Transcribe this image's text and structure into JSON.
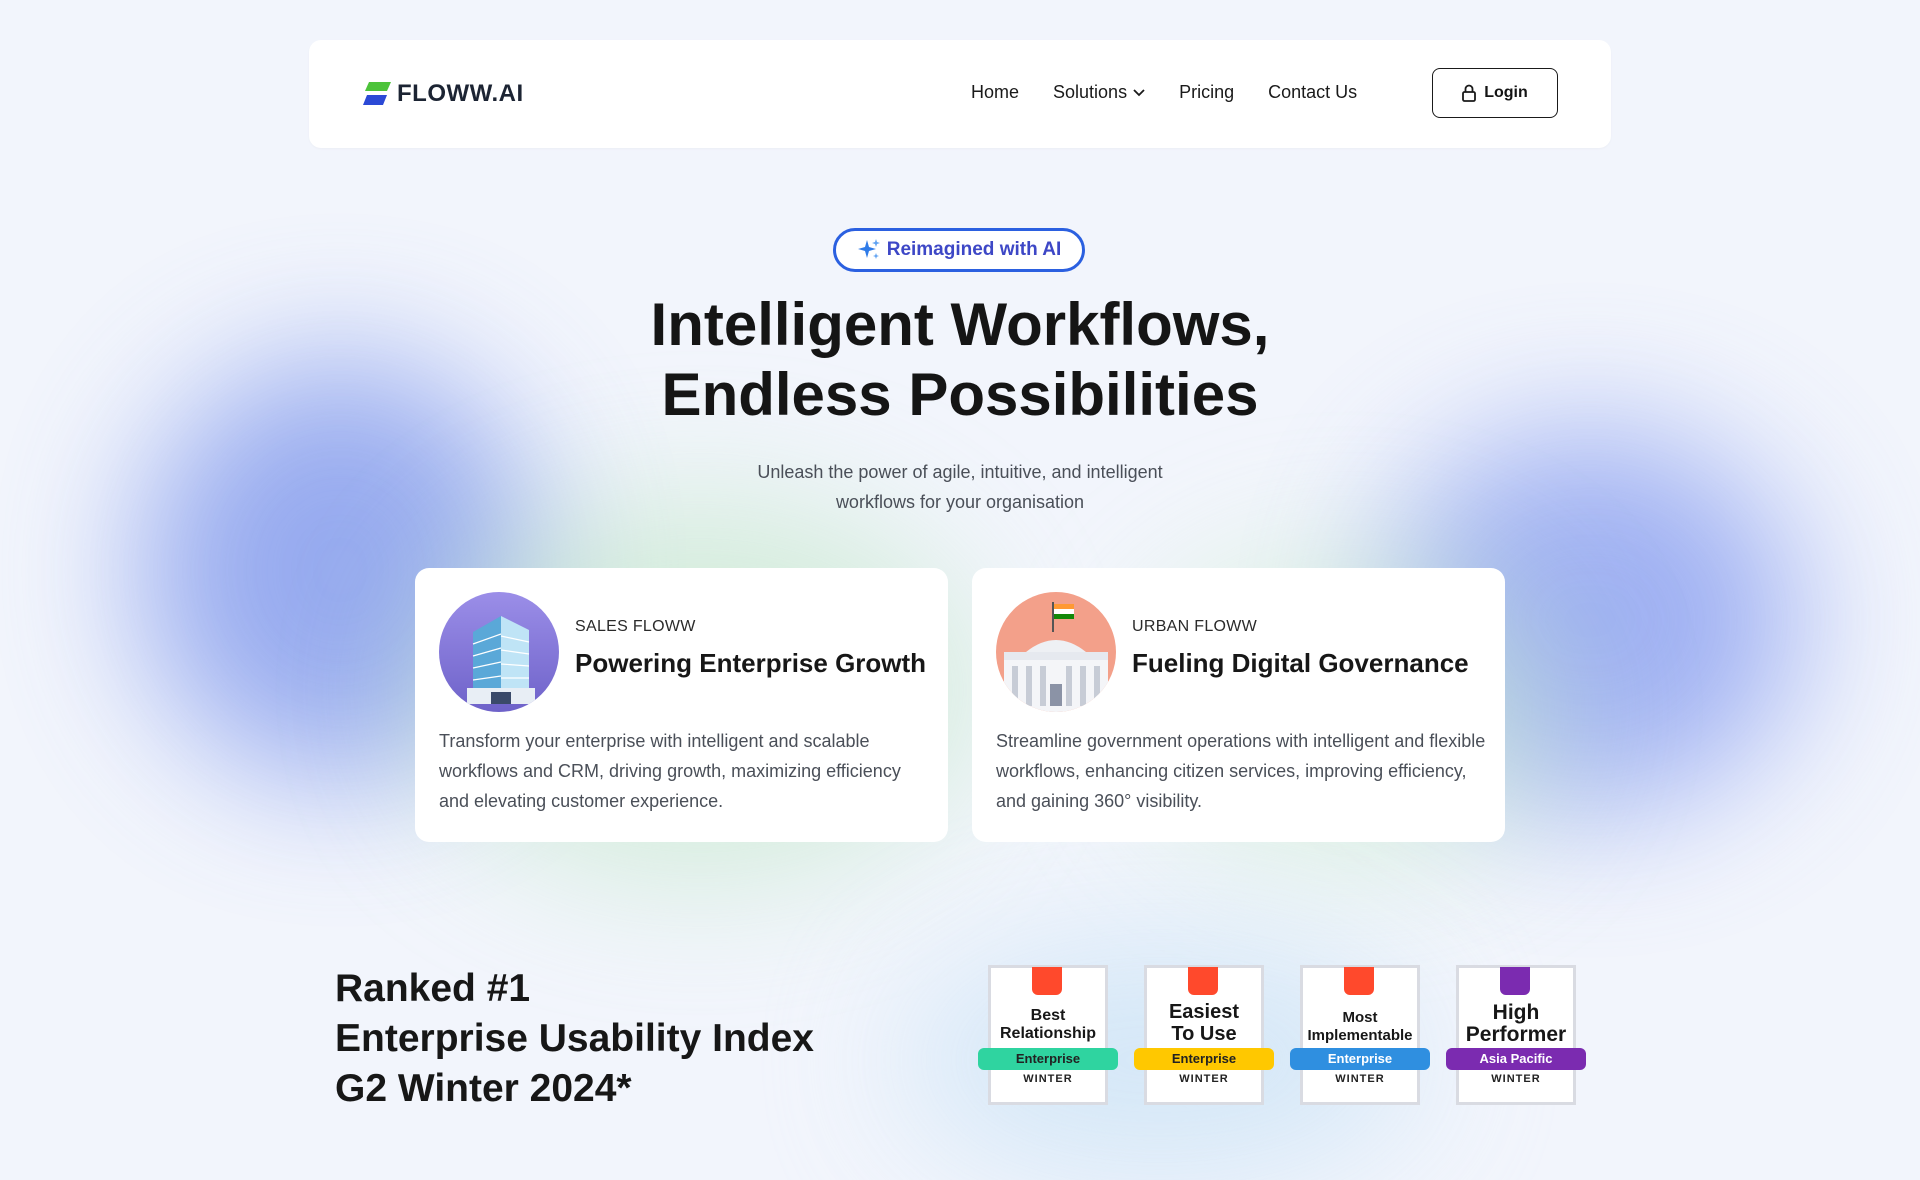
{
  "brand": {
    "name": "FLOWW.AI"
  },
  "nav": {
    "items": [
      {
        "label": "Home"
      },
      {
        "label": "Solutions"
      },
      {
        "label": "Pricing"
      },
      {
        "label": "Contact Us"
      }
    ],
    "login_label": "Login"
  },
  "hero": {
    "badge": "Reimagined with AI",
    "title_line1": "Intelligent Workflows,",
    "title_line2": "Endless Possibilities",
    "subtitle_line1": "Unleash the power of agile, intuitive, and intelligent",
    "subtitle_line2": "workflows for your organisation"
  },
  "cards": [
    {
      "kicker": "SALES FLOWW",
      "title": "Powering Enterprise Growth",
      "description": "Transform your enterprise with intelligent and scalable workflows and CRM, driving growth, maximizing efficiency and elevating customer experience.",
      "icon": "office-building-icon"
    },
    {
      "kicker": "URBAN FLOWW",
      "title": "Fueling Digital Governance",
      "description": "Streamline government operations with intelligent and flexible workflows, enhancing citizen services, improving efficiency, and gaining 360° visibility.",
      "icon": "government-building-icon"
    }
  ],
  "ranking": {
    "line1": "Ranked #1",
    "line2": "Enterprise Usability Index",
    "line3": "G2 Winter 2024*"
  },
  "g2_badges": [
    {
      "line1": "Best",
      "line2": "Relationship",
      "ribbon": "Enterprise",
      "ribbon_color": "#2fd4a0",
      "season": "WINTER",
      "logo_color": "#ff492c"
    },
    {
      "line1": "Easiest",
      "line2": "To Use",
      "ribbon": "Enterprise",
      "ribbon_color": "#ffc800",
      "season": "WINTER",
      "logo_color": "#ff492c"
    },
    {
      "line1": "Most",
      "line2": "Implementable",
      "ribbon": "Enterprise",
      "ribbon_color": "#2f8fe0",
      "season": "WINTER",
      "logo_color": "#ff492c"
    },
    {
      "line1": "High",
      "line2": "Performer",
      "ribbon": "Asia Pacific",
      "ribbon_color": "#7b2bb0",
      "season": "WINTER",
      "logo_color": "#7b2bb0"
    }
  ],
  "colors": {
    "accent_blue": "#2b60e0",
    "badge_text": "#3d47c6",
    "page_bg": "#f2f5fc"
  }
}
